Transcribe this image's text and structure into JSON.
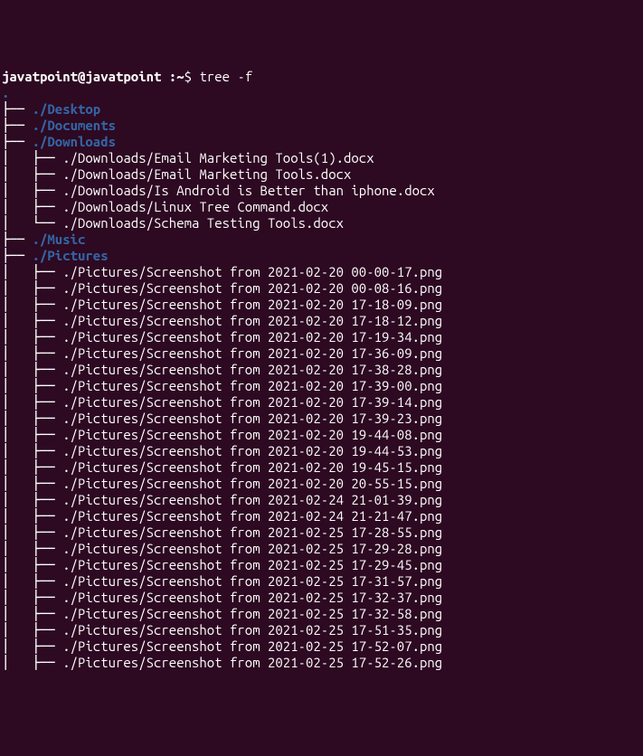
{
  "prompt": {
    "userhost": "javatpoint@javatpoint",
    "separator": " :",
    "path": "~",
    "symbol": "$",
    "command": "tree -f"
  },
  "tree": {
    "root": ".",
    "entries": [
      {
        "branch": "├── ",
        "type": "dir",
        "path": "./Desktop"
      },
      {
        "branch": "├── ",
        "type": "dir",
        "path": "./Documents"
      },
      {
        "branch": "├── ",
        "type": "dir",
        "path": "./Downloads"
      },
      {
        "branch": "│   ├── ",
        "type": "file",
        "path": "./Downloads/Email Marketing Tools(1).docx"
      },
      {
        "branch": "│   ├── ",
        "type": "file",
        "path": "./Downloads/Email Marketing Tools.docx"
      },
      {
        "branch": "│   ├── ",
        "type": "file",
        "path": "./Downloads/Is Android is Better than iphone.docx"
      },
      {
        "branch": "│   ├── ",
        "type": "file",
        "path": "./Downloads/Linux Tree Command.docx"
      },
      {
        "branch": "│   └── ",
        "type": "file",
        "path": "./Downloads/Schema Testing Tools.docx"
      },
      {
        "branch": "├── ",
        "type": "dir",
        "path": "./Music"
      },
      {
        "branch": "├── ",
        "type": "dir",
        "path": "./Pictures"
      },
      {
        "branch": "│   ├── ",
        "type": "file",
        "path": "./Pictures/Screenshot from 2021-02-20 00-00-17.png"
      },
      {
        "branch": "│   ├── ",
        "type": "file",
        "path": "./Pictures/Screenshot from 2021-02-20 00-08-16.png"
      },
      {
        "branch": "│   ├── ",
        "type": "file",
        "path": "./Pictures/Screenshot from 2021-02-20 17-18-09.png"
      },
      {
        "branch": "│   ├── ",
        "type": "file",
        "path": "./Pictures/Screenshot from 2021-02-20 17-18-12.png"
      },
      {
        "branch": "│   ├── ",
        "type": "file",
        "path": "./Pictures/Screenshot from 2021-02-20 17-19-34.png"
      },
      {
        "branch": "│   ├── ",
        "type": "file",
        "path": "./Pictures/Screenshot from 2021-02-20 17-36-09.png"
      },
      {
        "branch": "│   ├── ",
        "type": "file",
        "path": "./Pictures/Screenshot from 2021-02-20 17-38-28.png"
      },
      {
        "branch": "│   ├── ",
        "type": "file",
        "path": "./Pictures/Screenshot from 2021-02-20 17-39-00.png"
      },
      {
        "branch": "│   ├── ",
        "type": "file",
        "path": "./Pictures/Screenshot from 2021-02-20 17-39-14.png"
      },
      {
        "branch": "│   ├── ",
        "type": "file",
        "path": "./Pictures/Screenshot from 2021-02-20 17-39-23.png"
      },
      {
        "branch": "│   ├── ",
        "type": "file",
        "path": "./Pictures/Screenshot from 2021-02-20 19-44-08.png"
      },
      {
        "branch": "│   ├── ",
        "type": "file",
        "path": "./Pictures/Screenshot from 2021-02-20 19-44-53.png"
      },
      {
        "branch": "│   ├── ",
        "type": "file",
        "path": "./Pictures/Screenshot from 2021-02-20 19-45-15.png"
      },
      {
        "branch": "│   ├── ",
        "type": "file",
        "path": "./Pictures/Screenshot from 2021-02-20 20-55-15.png"
      },
      {
        "branch": "│   ├── ",
        "type": "file",
        "path": "./Pictures/Screenshot from 2021-02-24 21-01-39.png"
      },
      {
        "branch": "│   ├── ",
        "type": "file",
        "path": "./Pictures/Screenshot from 2021-02-24 21-21-47.png"
      },
      {
        "branch": "│   ├── ",
        "type": "file",
        "path": "./Pictures/Screenshot from 2021-02-25 17-28-55.png"
      },
      {
        "branch": "│   ├── ",
        "type": "file",
        "path": "./Pictures/Screenshot from 2021-02-25 17-29-28.png"
      },
      {
        "branch": "│   ├── ",
        "type": "file",
        "path": "./Pictures/Screenshot from 2021-02-25 17-29-45.png"
      },
      {
        "branch": "│   ├── ",
        "type": "file",
        "path": "./Pictures/Screenshot from 2021-02-25 17-31-57.png"
      },
      {
        "branch": "│   ├── ",
        "type": "file",
        "path": "./Pictures/Screenshot from 2021-02-25 17-32-37.png"
      },
      {
        "branch": "│   ├── ",
        "type": "file",
        "path": "./Pictures/Screenshot from 2021-02-25 17-32-58.png"
      },
      {
        "branch": "│   ├── ",
        "type": "file",
        "path": "./Pictures/Screenshot from 2021-02-25 17-51-35.png"
      },
      {
        "branch": "│   ├── ",
        "type": "file",
        "path": "./Pictures/Screenshot from 2021-02-25 17-52-07.png"
      },
      {
        "branch": "│   ├── ",
        "type": "file",
        "path": "./Pictures/Screenshot from 2021-02-25 17-52-26.png"
      }
    ]
  }
}
